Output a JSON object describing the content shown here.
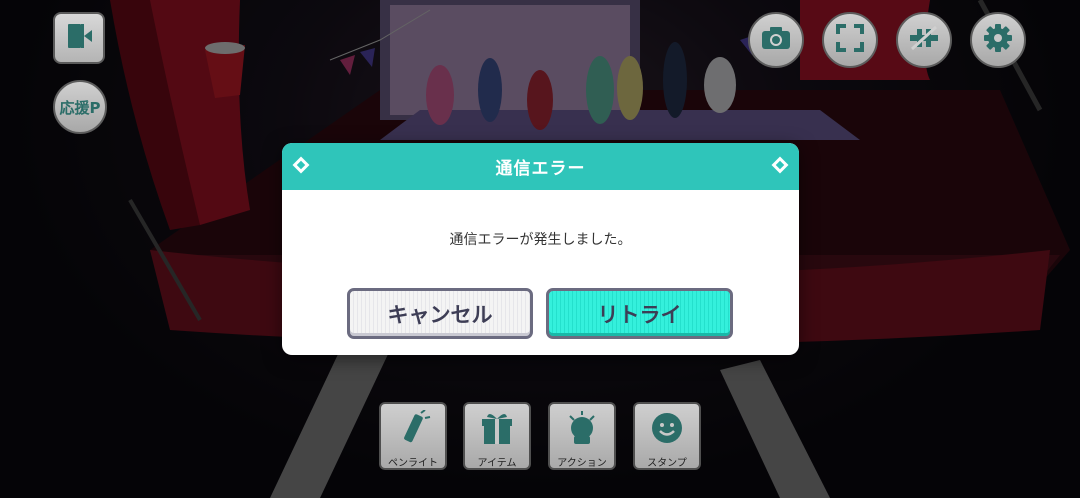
{
  "dialog": {
    "title": "通信エラー",
    "message": "通信エラーが発生しました。",
    "cancel_label": "キャンセル",
    "retry_label": "リトライ"
  },
  "hud": {
    "exit_icon": "door-exit-icon",
    "cheer_label": "応援P",
    "camera_icon": "camera-icon",
    "fullscreen_icon": "fullscreen-icon",
    "hide_ui_icon": "hide-ui-icon",
    "settings_icon": "gear-icon"
  },
  "actions": [
    {
      "label": "ペンライト",
      "icon": "penlight-icon"
    },
    {
      "label": "アイテム",
      "icon": "gift-icon"
    },
    {
      "label": "アクション",
      "icon": "action-icon"
    },
    {
      "label": "スタンプ",
      "icon": "smiley-icon"
    }
  ],
  "colors": {
    "accent": "#2fc5ba",
    "retry": "#34f0dc",
    "hud_icon": "#2b6d68"
  }
}
